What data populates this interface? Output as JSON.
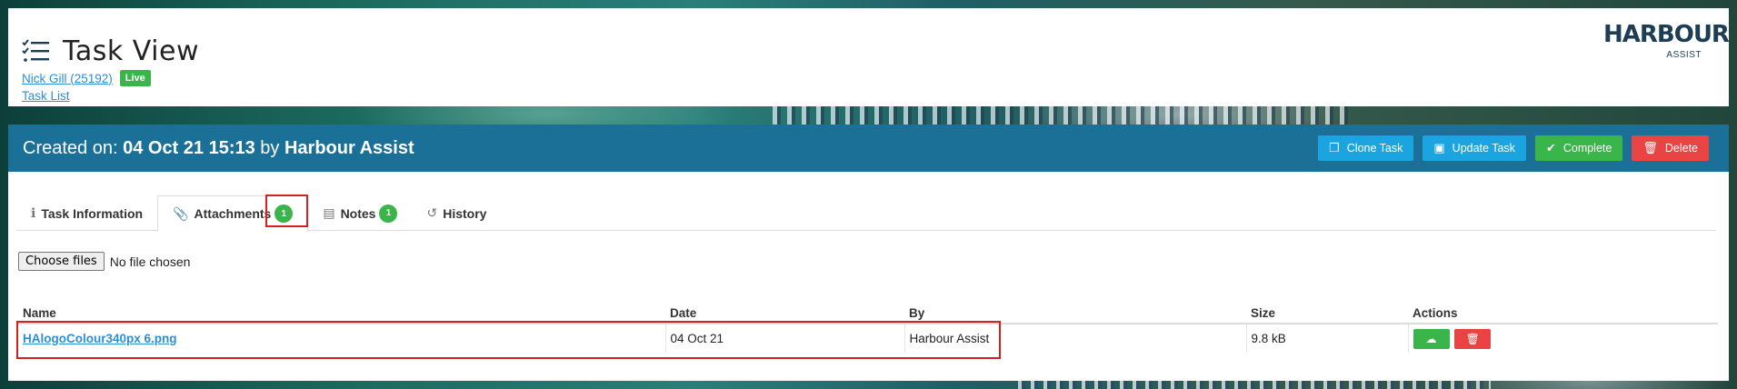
{
  "header": {
    "title": "Task View",
    "user_link": "Nick Gill (25192)",
    "status_badge": "Live",
    "task_list_link": "Task List",
    "logo_text": "HARBOUR",
    "logo_sub": "ASSIST"
  },
  "panel": {
    "created_prefix": "Created on:",
    "created_date": "04 Oct 21 15:13",
    "created_by_word": "by",
    "created_by": "Harbour Assist",
    "buttons": {
      "clone": "Clone Task",
      "update": "Update Task",
      "complete": "Complete",
      "delete": "Delete"
    }
  },
  "tabs": [
    {
      "label": "Task Information",
      "icon": "info-icon"
    },
    {
      "label": "Attachments",
      "icon": "paperclip-icon",
      "count": "1"
    },
    {
      "label": "Notes",
      "icon": "document-icon",
      "count": "1"
    },
    {
      "label": "History",
      "icon": "history-icon"
    }
  ],
  "upload": {
    "button_label": "Choose files",
    "status": "No file chosen"
  },
  "table": {
    "columns": [
      "Name",
      "Date",
      "By",
      "Size",
      "Actions"
    ],
    "rows": [
      {
        "name": "HAlogoColour340px 6.png",
        "date": "04 Oct 21",
        "by": "Harbour Assist",
        "size": "9.8 kB"
      }
    ]
  },
  "colors": {
    "header_bar": "#1a7097",
    "primary_button": "#1aa5e0",
    "success": "#3ab54a",
    "danger": "#e94343",
    "link": "#2a8fd6"
  }
}
